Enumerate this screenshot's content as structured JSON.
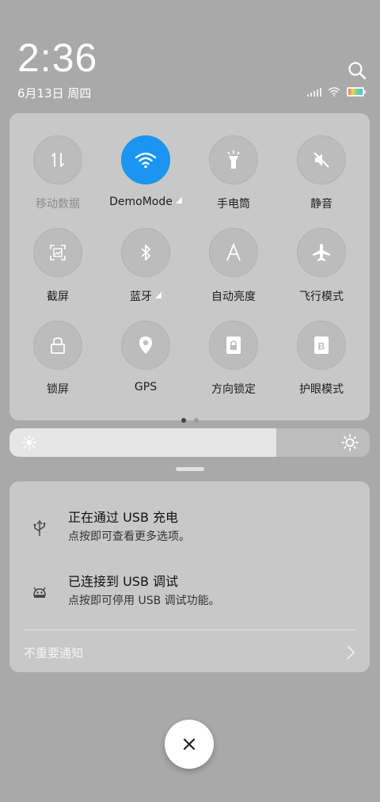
{
  "header": {
    "time": "2:36",
    "date": "6月13日 周四"
  },
  "quick_settings": {
    "tiles": [
      {
        "label": "移动数据",
        "icon": "mobile-data-icon",
        "active": false,
        "dim": true
      },
      {
        "label": "DemoMode",
        "icon": "wifi-icon",
        "active": true
      },
      {
        "label": "手电筒",
        "icon": "flashlight-icon",
        "active": false
      },
      {
        "label": "静音",
        "icon": "mute-icon",
        "active": false
      },
      {
        "label": "截屏",
        "icon": "screenshot-icon",
        "active": false
      },
      {
        "label": "蓝牙",
        "icon": "bluetooth-icon",
        "active": false
      },
      {
        "label": "自动亮度",
        "icon": "auto-brightness-icon",
        "active": false
      },
      {
        "label": "飞行模式",
        "icon": "airplane-icon",
        "active": false
      },
      {
        "label": "锁屏",
        "icon": "lock-icon",
        "active": false
      },
      {
        "label": "GPS",
        "icon": "gps-pin-icon",
        "active": false
      },
      {
        "label": "方向锁定",
        "icon": "rotation-lock-icon",
        "active": false
      },
      {
        "label": "护眼模式",
        "icon": "eye-protection-icon",
        "active": false
      }
    ],
    "page_count": 2,
    "current_page": 1,
    "accent_color": "#1a95f0"
  },
  "brightness": {
    "level": 0.74
  },
  "notifications": {
    "items": [
      {
        "title": "正在通过  USB  充电",
        "subtitle": "点按即可查看更多选项。",
        "icon": "usb-icon"
      },
      {
        "title": "已连接到  USB  调试",
        "subtitle": "点按即可停用 USB 调试功能。",
        "icon": "android-debug-icon"
      }
    ],
    "unimportant_label": "不重要通知"
  }
}
